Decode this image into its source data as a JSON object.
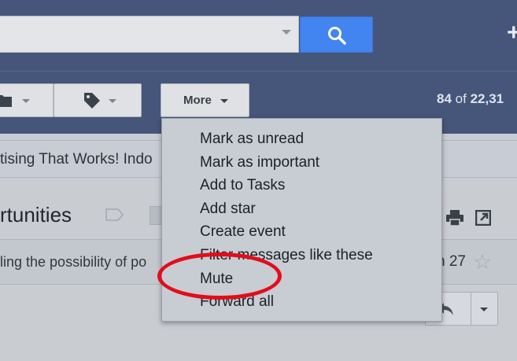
{
  "header": {
    "search": {
      "value": "",
      "placeholder": ""
    },
    "search_button_icon": "search-icon",
    "create_icon": "plus-icon",
    "create_label": "+"
  },
  "toolbar": {
    "folder_icon": "folder-icon",
    "label_icon": "label-tag-icon",
    "more_label": "More",
    "count_start": "84",
    "count_of": "of",
    "count_total": "22,31"
  },
  "ad": {
    "text": "tising That Works! Indo"
  },
  "message": {
    "subject": "rtunities",
    "snippet": "ling the possibility of po",
    "date": "n 27",
    "star_glyph": "☆"
  },
  "more_menu": {
    "items": [
      "Mark as unread",
      "Mark as important",
      "Add to Tasks",
      "Add star",
      "Create event",
      "Filter messages like these",
      "Mute",
      "Forward all"
    ],
    "highlighted": "Mute"
  },
  "colors": {
    "header_bg": "#46567a",
    "search_button": "#4284f0",
    "highlight_ring": "#e30d1a"
  }
}
